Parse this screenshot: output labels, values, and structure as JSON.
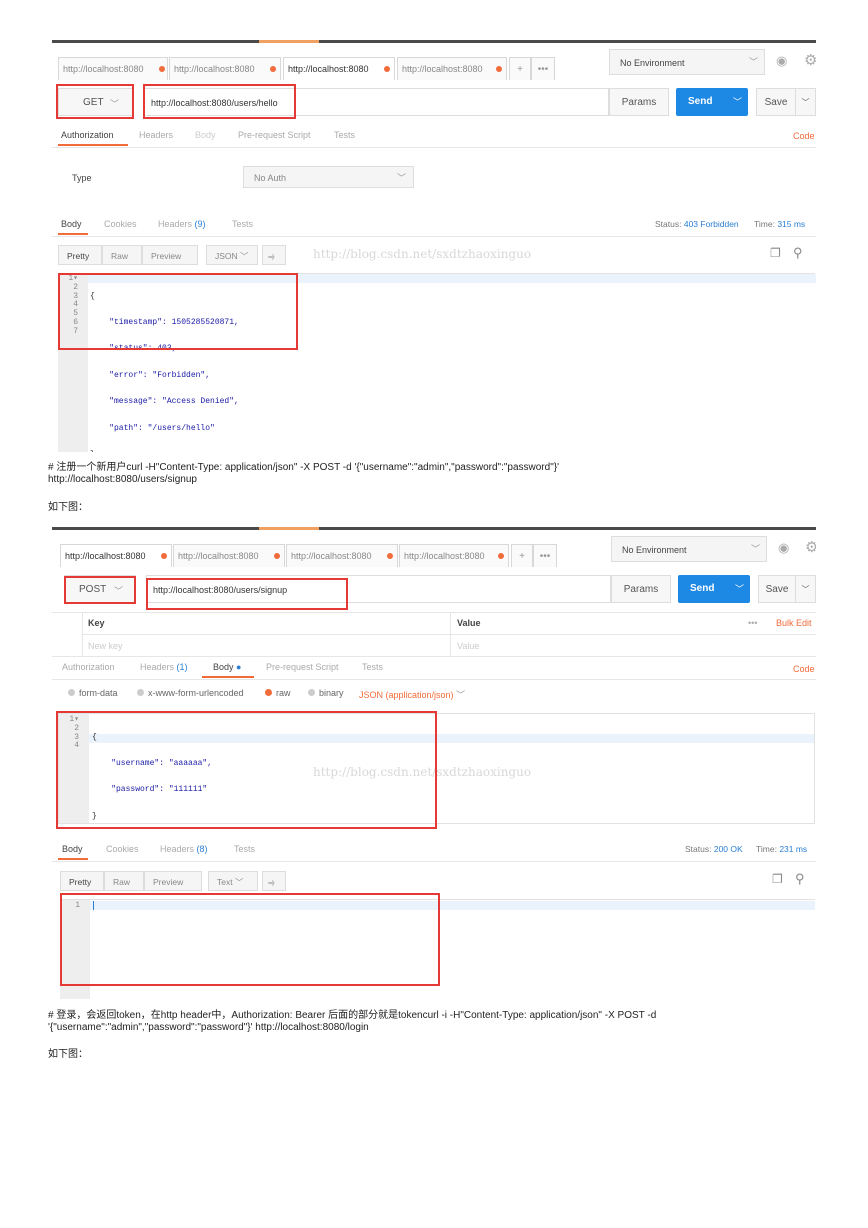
{
  "s1": {
    "tabs": [
      "http://localhost:8080",
      "http://localhost:8080",
      "http://localhost:8080",
      "http://localhost:8080"
    ],
    "tab_plus": "+",
    "tab_more": "•••",
    "env": "No Environment",
    "method": "GET",
    "url": "http://localhost:8080/users/hello",
    "params": "Params",
    "send": "Send",
    "save": "Save",
    "req_tabs": [
      "Authorization",
      "Headers",
      "Body",
      "Pre-request Script",
      "Tests"
    ],
    "code_link": "Code",
    "type_label": "Type",
    "auth_value": "No Auth",
    "resp_tabs": [
      "Body",
      "Cookies",
      "Headers",
      "Tests"
    ],
    "headers_count": "(9)",
    "status_label": "Status:",
    "status_value": "403 Forbidden",
    "time_label": "Time:",
    "time_value": "315 ms",
    "view_pretty": "Pretty",
    "view_raw": "Raw",
    "view_preview": "Preview",
    "format": "JSON",
    "watermark": "http://blog.csdn.net/sxdtzhaoxinguo",
    "code_lines": [
      "{",
      "    \"timestamp\": 1505285520871,",
      "    \"status\": 403,",
      "    \"error\": \"Forbidden\",",
      "    \"message\": \"Access Denied\",",
      "    \"path\": \"/users/hello\"",
      "}"
    ]
  },
  "para1_line1": "# 注册一个新用户curl -H\"Content-Type: application/json\" -X POST -d '{\"username\":\"admin\",\"password\":\"password\"}'",
  "para1_line2": "http://localhost:8080/users/signup",
  "fig_label_1": "如下图：",
  "s2": {
    "tabs": [
      "http://localhost:8080",
      "http://localhost:8080",
      "http://localhost:8080",
      "http://localhost:8080"
    ],
    "tab_plus": "+",
    "tab_more": "•••",
    "env": "No Environment",
    "method": "POST",
    "url": "http://localhost:8080/users/signup",
    "params": "Params",
    "send": "Send",
    "save": "Save",
    "key_header": "Key",
    "value_header": "Value",
    "more": "•••",
    "bulk_edit": "Bulk Edit",
    "key_placeholder": "New key",
    "value_placeholder": "Value",
    "req_tabs": [
      "Authorization",
      "Headers",
      "Body",
      "Pre-request Script",
      "Tests"
    ],
    "headers_count": "(1)",
    "code_link": "Code",
    "body_types": [
      "form-data",
      "x-www-form-urlencoded",
      "raw",
      "binary"
    ],
    "content_type": "JSON (application/json)",
    "req_code_lines": [
      "{",
      "    \"username\": \"aaaaaa\",",
      "    \"password\": \"111111\"",
      "}"
    ],
    "watermark": "http://blog.csdn.net/sxdtzhaoxinguo",
    "resp_tabs": [
      "Body",
      "Cookies",
      "Headers",
      "Tests"
    ],
    "resp_headers_count": "(8)",
    "status_label": "Status:",
    "status_value": "200 OK",
    "time_label": "Time:",
    "time_value": "231 ms",
    "view_pretty": "Pretty",
    "view_raw": "Raw",
    "view_preview": "Preview",
    "format": "Text",
    "resp_line": "1"
  },
  "para2_line1": "# 登录，会返回token，在http header中，Authorization: Bearer 后面的部分就是tokencurl -i -H\"Content-Type: application/json\" -X POST -d",
  "para2_line2": "'{\"username\":\"admin\",\"password\":\"password\"}' http://localhost:8080/login",
  "fig_label_2": "如下图："
}
